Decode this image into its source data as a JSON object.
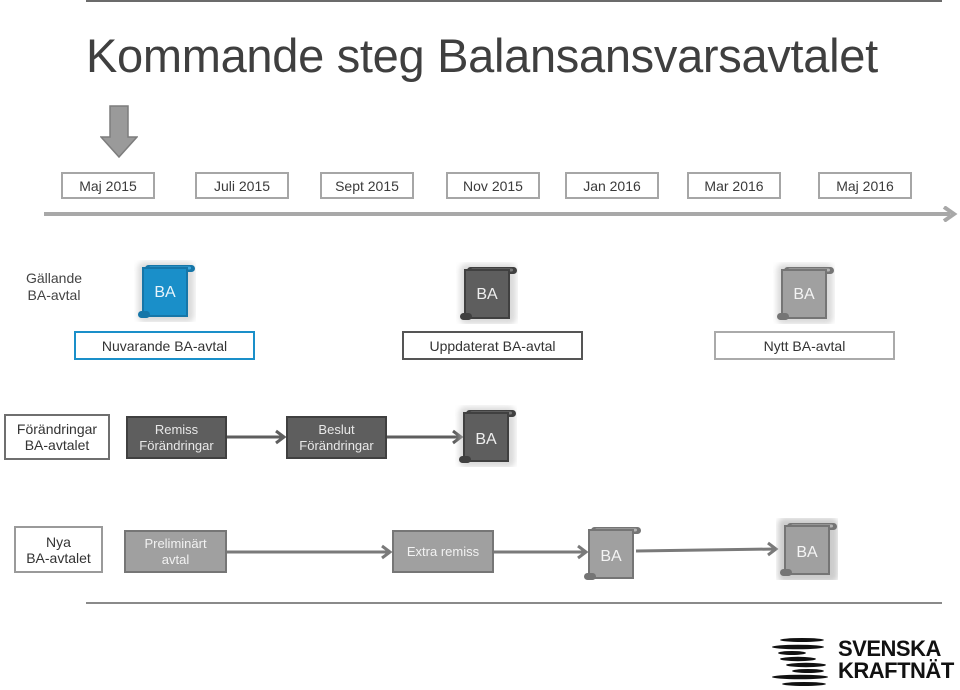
{
  "title": "Kommande steg Balansansvarsavtalet",
  "current_marker": "down-arrow",
  "timeline": {
    "dates": [
      "Maj 2015",
      "Juli 2015",
      "Sept 2015",
      "Nov 2015",
      "Jan 2016",
      "Mar 2016",
      "Maj 2016"
    ]
  },
  "row_current": {
    "label_line1": "Gällande",
    "label_line2": "BA-avtal",
    "stages": [
      {
        "doc": "BA",
        "caption": "Nuvarande BA-avtal",
        "color": "#1a8fc9"
      },
      {
        "doc": "BA",
        "caption": "Uppdaterat BA-avtal",
        "color": "#5e5e5e"
      },
      {
        "doc": "BA",
        "caption": "Nytt BA-avtal",
        "color": "#a0a0a0"
      }
    ]
  },
  "row_changes": {
    "label_line1": "Förändringar",
    "label_line2": "BA-avtalet",
    "steps": [
      {
        "line1": "Remiss",
        "line2": "Förändringar"
      },
      {
        "line1": "Beslut",
        "line2": "Förändringar"
      }
    ],
    "doc": "BA"
  },
  "row_new": {
    "label_line1": "Nya",
    "label_line2": "BA-avtalet",
    "steps": [
      {
        "line1": "Preliminärt",
        "line2": "avtal"
      },
      {
        "line1": "Extra remiss"
      }
    ],
    "docs": [
      "BA",
      "BA"
    ]
  },
  "logo": {
    "line1": "SVENSKA",
    "line2": "KRAFTNÄT"
  },
  "colors": {
    "accent_blue": "#1a8fc9",
    "dark_gray": "#5e5e5e",
    "mid_gray": "#a0a0a0"
  }
}
